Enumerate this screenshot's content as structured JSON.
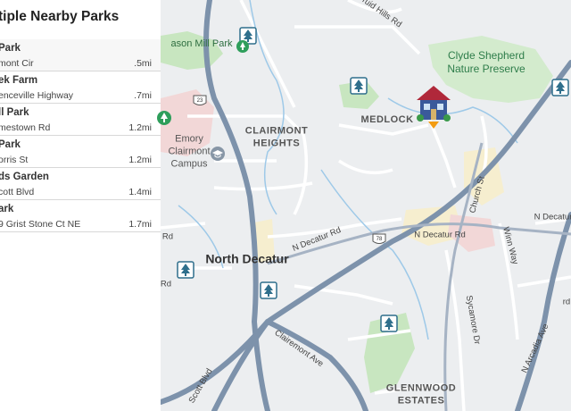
{
  "panel": {
    "title": "tiple Nearby Parks",
    "parks": [
      {
        "name": "Park",
        "address": "mont Cir",
        "distance": ".5mi"
      },
      {
        "name": "ek Farm",
        "address": "enceville Highway",
        "distance": ".7mi"
      },
      {
        "name": "ll Park",
        "address": "mestown Rd",
        "distance": "1.2mi"
      },
      {
        "name": "Park",
        "address": "orris St",
        "distance": "1.2mi"
      },
      {
        "name": "ds Garden",
        "address": "cott Blvd",
        "distance": "1.4mi"
      },
      {
        "name": "ark",
        "address": "9 Grist Stone Ct NE",
        "distance": "1.7mi"
      }
    ]
  },
  "map": {
    "labels": {
      "mason_mill_park": "ason Mill Park",
      "clyde_shepherd": "Clyde Shepherd Nature Preserve",
      "medlock": "MEDLOCK",
      "clairmont_heights": "CLAIRMONT HEIGHTS",
      "emory_clairmont": "Emory Clairmont Campus",
      "north_decatur": "North Decatur",
      "glennwood_estates": "GLENNWOOD ESTATES"
    },
    "roads": {
      "druid_hills_rd": "ruid Hills Rd",
      "n_decatur_rd_west": "N Decatur Rd",
      "n_decatur_rd_east": "N Decatur Rd",
      "n_decatur_rd_far": "N Decatur",
      "church_st": "Church St",
      "winn_way": "Winn Way",
      "sycamore_dr": "Sycamore Dr",
      "clairemont_ave": "Clairemont Ave",
      "scott_blvd": "Scott Blvd",
      "n_arcadia_ave": "N Arcadia Ave",
      "rd_fragment_1": "Rd",
      "rd_fragment_2": "Rd",
      "rd_fragment_3": "rd"
    },
    "shields": {
      "us_23": "23",
      "us_78": "78"
    },
    "colors": {
      "park_green": "#c8e6c0",
      "tree_pin": "#2f6f8c",
      "home_pin_accent": "#f39c12",
      "major_road": "#7d92ab",
      "minor_road": "#ffffff",
      "stream": "#9ec9e8"
    }
  }
}
